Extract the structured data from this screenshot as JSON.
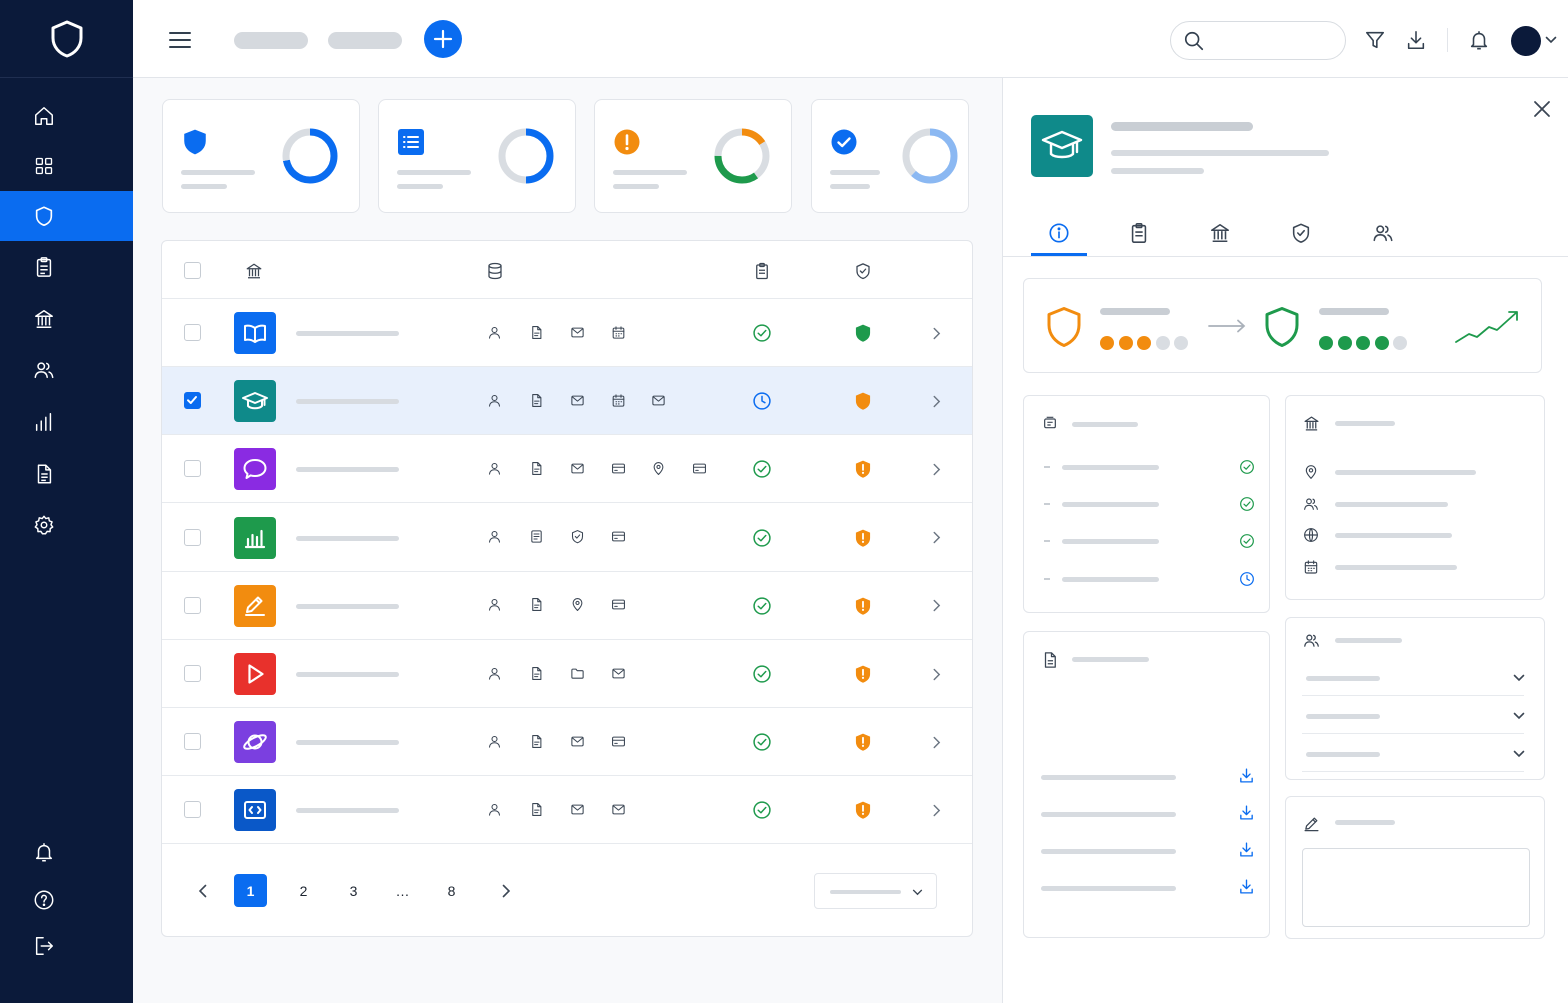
{
  "colors": {
    "sidebar_bg": "#0b1a3a",
    "accent": "#0a6cf0",
    "success": "#1e9a4c",
    "warning": "#f28c0f"
  },
  "sidebar": {
    "logo_icon": "shield-outline-icon",
    "items": [
      {
        "icon": "home-icon",
        "active": false
      },
      {
        "icon": "grid-icon",
        "active": false
      },
      {
        "icon": "shield-icon",
        "active": true
      },
      {
        "icon": "clipboard-icon",
        "active": false
      },
      {
        "icon": "institution-icon",
        "active": false
      },
      {
        "icon": "users-icon",
        "active": false
      },
      {
        "icon": "bar-chart-icon",
        "active": false
      },
      {
        "icon": "document-icon",
        "active": false
      },
      {
        "icon": "gear-icon",
        "active": false
      }
    ],
    "bottom_items": [
      {
        "icon": "bell-icon"
      },
      {
        "icon": "help-icon"
      },
      {
        "icon": "logout-icon"
      }
    ]
  },
  "topbar": {
    "icons": [
      "menu-icon",
      "plus-icon",
      "search-icon",
      "filter-icon",
      "download-icon",
      "bell-icon",
      "chevron-down-icon"
    ],
    "search": {
      "value": "",
      "placeholder": ""
    }
  },
  "summary_cards": [
    {
      "icon": "shield-icon",
      "icon_color": "#0a6cf0",
      "segments": [
        {
          "color": "#0a6cf0",
          "fraction": 0.72
        },
        {
          "color": "#d9dde2",
          "fraction": 0.28
        }
      ]
    },
    {
      "icon": "list-icon",
      "icon_color": "#0a6cf0",
      "segments": [
        {
          "color": "#0a6cf0",
          "fraction": 0.5
        },
        {
          "color": "#d9dde2",
          "fraction": 0.5
        }
      ]
    },
    {
      "icon": "alert-icon",
      "icon_color": "#f28c0f",
      "segments": [
        {
          "color": "#f28c0f",
          "fraction": 0.16
        },
        {
          "color": "#d9dde2",
          "fraction": 0.24
        },
        {
          "color": "#1e9a4c",
          "fraction": 0.35
        },
        {
          "color": "#d9dde2",
          "fraction": 0.25
        }
      ]
    },
    {
      "icon": "check-circle-icon",
      "icon_color": "#0a6cf0",
      "segments": [
        {
          "color": "#8bb8f2",
          "fraction": 0.62
        },
        {
          "color": "#d9dde2",
          "fraction": 0.38
        }
      ]
    }
  ],
  "table": {
    "header_icons": [
      "institution-icon",
      "database-icon",
      "clipboard-icon",
      "shield-check-icon"
    ],
    "rows": [
      {
        "app_icon": "book-icon",
        "app_color": "#0a6cf0",
        "selected": false,
        "data_types": [
          "person-icon",
          "file-icon",
          "mail-icon",
          "calendar-icon"
        ],
        "status": "complete",
        "risk": "low"
      },
      {
        "app_icon": "graduation-cap-icon",
        "app_color": "#0f8a8a",
        "selected": true,
        "data_types": [
          "person-icon",
          "file-icon",
          "mail-icon",
          "calendar-icon",
          "mail-icon"
        ],
        "status": "pending",
        "risk": "medium"
      },
      {
        "app_icon": "chat-bubble-icon",
        "app_color": "#8a2be2",
        "selected": false,
        "data_types": [
          "person-icon",
          "file-icon",
          "mail-icon",
          "card-icon",
          "location-icon",
          "card-icon"
        ],
        "status": "complete",
        "risk": "high"
      },
      {
        "app_icon": "bar-chart-icon",
        "app_color": "#1e9a4c",
        "selected": false,
        "data_types": [
          "person-icon",
          "note-icon",
          "shield-check-icon",
          "card-icon"
        ],
        "status": "complete",
        "risk": "high"
      },
      {
        "app_icon": "pencil-icon",
        "app_color": "#f28c0f",
        "selected": false,
        "data_types": [
          "person-icon",
          "file-icon",
          "location-icon",
          "card-icon"
        ],
        "status": "complete",
        "risk": "high"
      },
      {
        "app_icon": "play-icon",
        "app_color": "#e8312c",
        "selected": false,
        "data_types": [
          "person-icon",
          "file-icon",
          "folder-icon",
          "mail-icon"
        ],
        "status": "complete",
        "risk": "high"
      },
      {
        "app_icon": "planet-icon",
        "app_color": "#7b3fe0",
        "selected": false,
        "data_types": [
          "person-icon",
          "file-icon",
          "mail-icon",
          "card-icon"
        ],
        "status": "complete",
        "risk": "high"
      },
      {
        "app_icon": "code-icon",
        "app_color": "#0a58c8",
        "selected": false,
        "data_types": [
          "person-icon",
          "file-icon",
          "mail-icon",
          "mail-icon"
        ],
        "status": "complete",
        "risk": "high"
      }
    ]
  },
  "pagination": {
    "pages": [
      "1",
      "2",
      "3",
      "…",
      "8"
    ],
    "current": "1"
  },
  "panel": {
    "app_icon": "graduation-cap-icon",
    "app_color": "#0f8a8a",
    "tabs": [
      {
        "icon": "info-icon",
        "active": true
      },
      {
        "icon": "clipboard-icon",
        "active": false
      },
      {
        "icon": "institution-icon",
        "active": false
      },
      {
        "icon": "shield-check-icon",
        "active": false
      },
      {
        "icon": "users-icon",
        "active": false
      }
    ],
    "score": {
      "from_level": 3,
      "to_level": 4,
      "max": 5
    },
    "checklist": [
      "complete",
      "complete",
      "complete",
      "pending"
    ],
    "info_icons": [
      "location-icon",
      "users-icon",
      "globe-icon",
      "calendar-icon"
    ],
    "documents": 4,
    "dropdowns": 3,
    "notes": {
      "value": "",
      "placeholder": ""
    }
  }
}
